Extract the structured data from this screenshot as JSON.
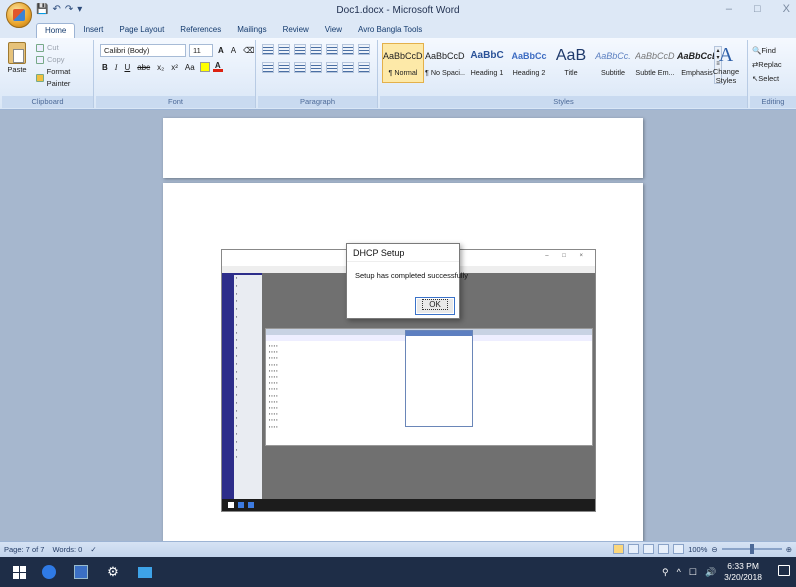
{
  "window": {
    "title": "Doc1.docx - Microsoft Word",
    "controls": [
      "–",
      "□",
      "X"
    ]
  },
  "tabs": [
    "Home",
    "Insert",
    "Page Layout",
    "References",
    "Mailings",
    "Review",
    "View",
    "Avro Bangla Tools"
  ],
  "clipboard": {
    "paste": "Paste",
    "cut": "Cut",
    "copy": "Copy",
    "format_painter": "Format Painter",
    "label": "Clipboard"
  },
  "font": {
    "name": "Calibri (Body)",
    "size": "11",
    "label": "Font"
  },
  "paragraph": {
    "label": "Paragraph"
  },
  "styles": {
    "label": "Styles",
    "items": [
      {
        "sample": "AaBbCcDc",
        "name": "¶ Normal"
      },
      {
        "sample": "AaBbCcDc",
        "name": "¶ No Spaci..."
      },
      {
        "sample": "AaBbC",
        "name": "Heading 1"
      },
      {
        "sample": "AaBbCc",
        "name": "Heading 2"
      },
      {
        "sample": "AaB",
        "name": "Title"
      },
      {
        "sample": "AaBbCc.",
        "name": "Subtitle"
      },
      {
        "sample": "AaBbCcDı",
        "name": "Subtle Em..."
      },
      {
        "sample": "AaBbCcDı",
        "name": "Emphasis"
      }
    ],
    "change_styles": "Change Styles"
  },
  "editing": {
    "label": "Editing",
    "find": "Find",
    "replace": "Replac",
    "select": "Select"
  },
  "dialog": {
    "title": "DHCP Setup",
    "message": "Setup has completed successfully",
    "ok": "OK"
  },
  "statusbar": {
    "page": "Page: 7 of 7",
    "words": "Words: 0",
    "zoom": "100%"
  },
  "taskbar": {
    "time": "6:33 PM",
    "date": "3/20/2018"
  }
}
